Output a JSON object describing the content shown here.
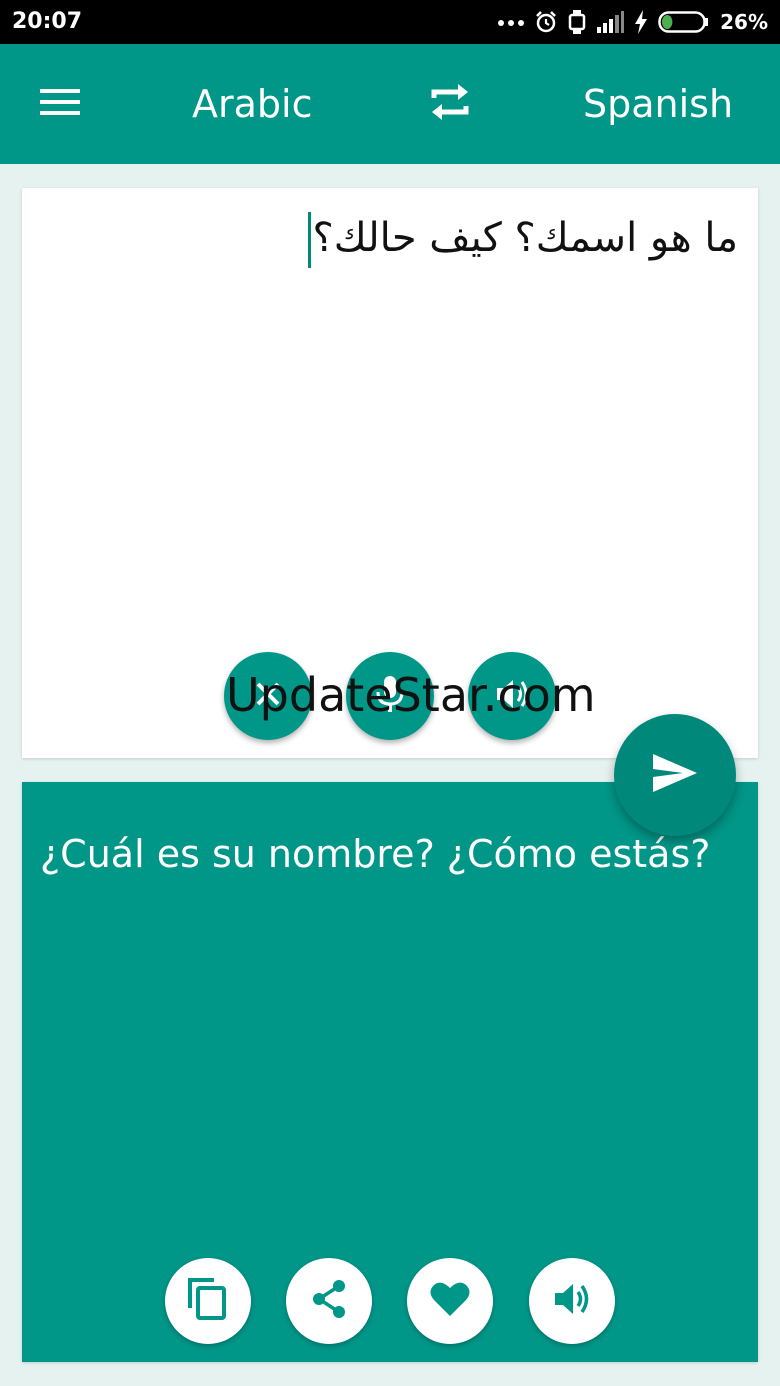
{
  "status_bar": {
    "time": "20:07",
    "battery_percent": "26%",
    "battery_level": 0.26,
    "icons": [
      "more-dots-icon",
      "alarm-icon",
      "watch-icon",
      "signal-icon",
      "charging-icon",
      "battery-icon"
    ]
  },
  "app_bar": {
    "source_language": "Arabic",
    "target_language": "Spanish",
    "icons": [
      "menu-icon",
      "swap-icon"
    ]
  },
  "input": {
    "text": "ما هو اسمك؟ كيف حالك؟",
    "actions": [
      "close-icon",
      "mic-icon",
      "speaker-icon"
    ]
  },
  "watermark": "UpdateStar.com",
  "output": {
    "text": "¿Cuál es su nombre? ¿Cómo estás?",
    "actions": [
      "copy-icon",
      "share-icon",
      "heart-icon",
      "speaker-icon"
    ]
  },
  "colors": {
    "primary": "#009688",
    "primary_dark": "#00897b",
    "background": "#e6f2f0",
    "card": "#ffffff",
    "status_bar": "#000000",
    "battery_green": "#4caf50"
  }
}
